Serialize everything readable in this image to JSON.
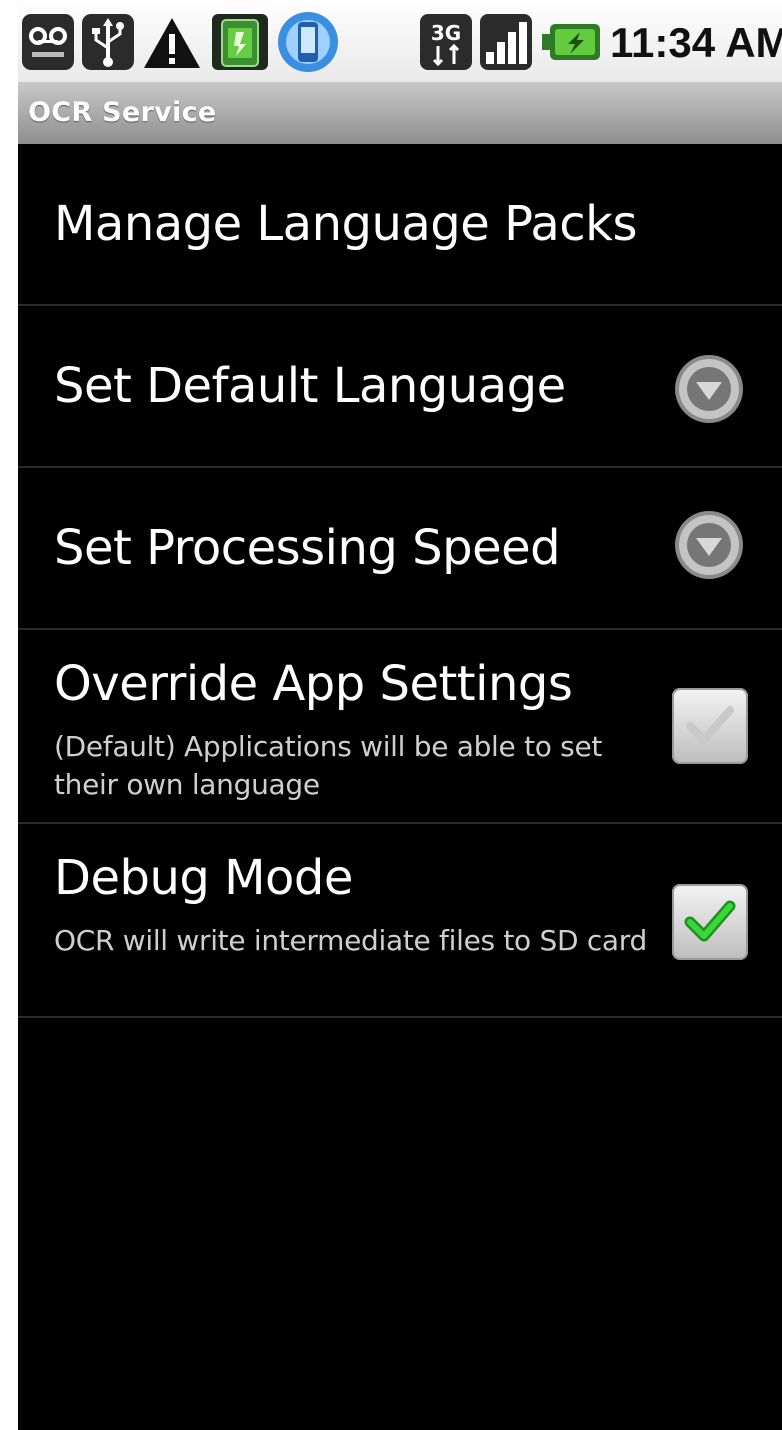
{
  "status_bar": {
    "time": "11:34 AM",
    "icons": [
      "voicemail-icon",
      "usb-icon",
      "warning-icon",
      "battery-app-icon",
      "sync-icon",
      "3g-icon",
      "signal-icon",
      "battery-charging-icon"
    ],
    "network_label": "3G"
  },
  "app": {
    "title": "OCR Service"
  },
  "preferences": [
    {
      "title": "Manage Language Packs"
    },
    {
      "title": "Set Default Language",
      "widget": "dropdown"
    },
    {
      "title": "Set Processing Speed",
      "widget": "dropdown"
    },
    {
      "title": "Override App Settings",
      "summary": "(Default) Applications will be able to set their own language",
      "widget": "checkbox",
      "checked": false
    },
    {
      "title": "Debug Mode",
      "summary": "OCR will write intermediate files to SD card",
      "widget": "checkbox",
      "checked": true
    }
  ],
  "colors": {
    "background": "#000000",
    "divider": "#2a2a2a",
    "check_green": "#2ec52e",
    "title_bar": "#a8a8a8"
  }
}
